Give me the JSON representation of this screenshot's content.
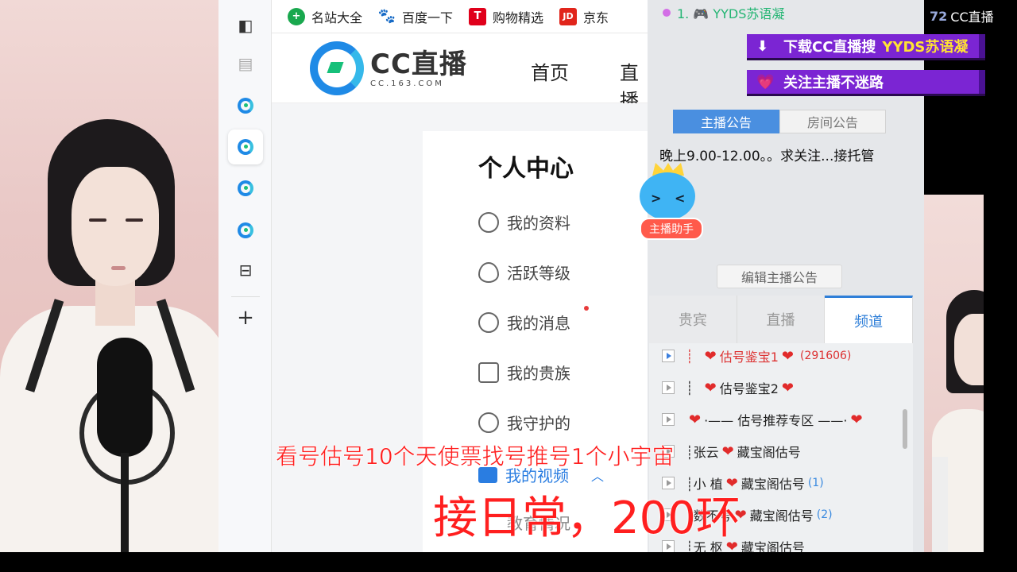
{
  "bookmarks": [
    {
      "label": "名站大全",
      "icon": "add-circle-icon",
      "color": "#19a84e"
    },
    {
      "label": "百度一下",
      "icon": "baidu-paw-icon",
      "color": "#2f6fe0"
    },
    {
      "label": "购物精选",
      "icon": "tmall-icon",
      "color": "#e0001b"
    },
    {
      "label": "京东",
      "icon": "jd-icon",
      "color": "#e1251b"
    }
  ],
  "nav": {
    "logo_main": "CC直播",
    "logo_sub": "CC.163.COM",
    "links": [
      "首页",
      "直播"
    ]
  },
  "personal_center": {
    "title": "个人中心",
    "items": [
      {
        "label": "我的资料",
        "icon": "user-icon"
      },
      {
        "label": "活跃等级",
        "icon": "flame-icon"
      },
      {
        "label": "我的消息",
        "icon": "message-icon"
      },
      {
        "label": "我的贵族",
        "icon": "crown-icon"
      },
      {
        "label": "我守护的",
        "icon": "guard-icon"
      },
      {
        "label": "我的视频",
        "icon": "video-icon"
      },
      {
        "label": "教育情况",
        "icon": "education-icon"
      }
    ]
  },
  "panel": {
    "marquee": "1. 🎮 YYDS苏语凝",
    "cc_badge_num": "72",
    "cc_badge_label": "CC直播",
    "banner_download": "下载CC直播搜",
    "banner_download_name": "YYDS苏语凝",
    "banner_follow": "关注主播不迷路",
    "ann_tabs": [
      "主播公告",
      "房间公告"
    ],
    "ann_text": "晚上9.00-12.00。。求关注...接托管",
    "mascot_tag": "主播助手",
    "edit_button": "编辑主播公告",
    "channel_tabs": [
      "贵宾",
      "直播",
      "频道"
    ],
    "channels": [
      {
        "prefix": "┊",
        "name": "估号鉴宝1",
        "count": "(291606)"
      },
      {
        "prefix": "┊",
        "name": "估号鉴宝2",
        "count": ""
      },
      {
        "prefix": "",
        "name": "·—— 估号推荐专区 ——·",
        "count": ""
      },
      {
        "prefix": "┊张云",
        "name": "藏宝阁估号",
        "count": ""
      },
      {
        "prefix": "┊小 植",
        "name": "藏宝阁估号",
        "count": "(1)"
      },
      {
        "prefix": "┊数不号",
        "name": "藏宝阁估号",
        "count": "(2)"
      },
      {
        "prefix": "┊无 枢",
        "name": "藏宝阁估号",
        "count": ""
      }
    ]
  },
  "subtitles": {
    "line1": "看号估号10个天使票找号推号1个小宇宙",
    "line2": "接日常，200环"
  },
  "colors": {
    "accent_blue": "#4a8fe0",
    "banner_purple": "#7b25d3",
    "subtitle_red": "#ff1f1f",
    "heart_red": "#e12b2b"
  }
}
